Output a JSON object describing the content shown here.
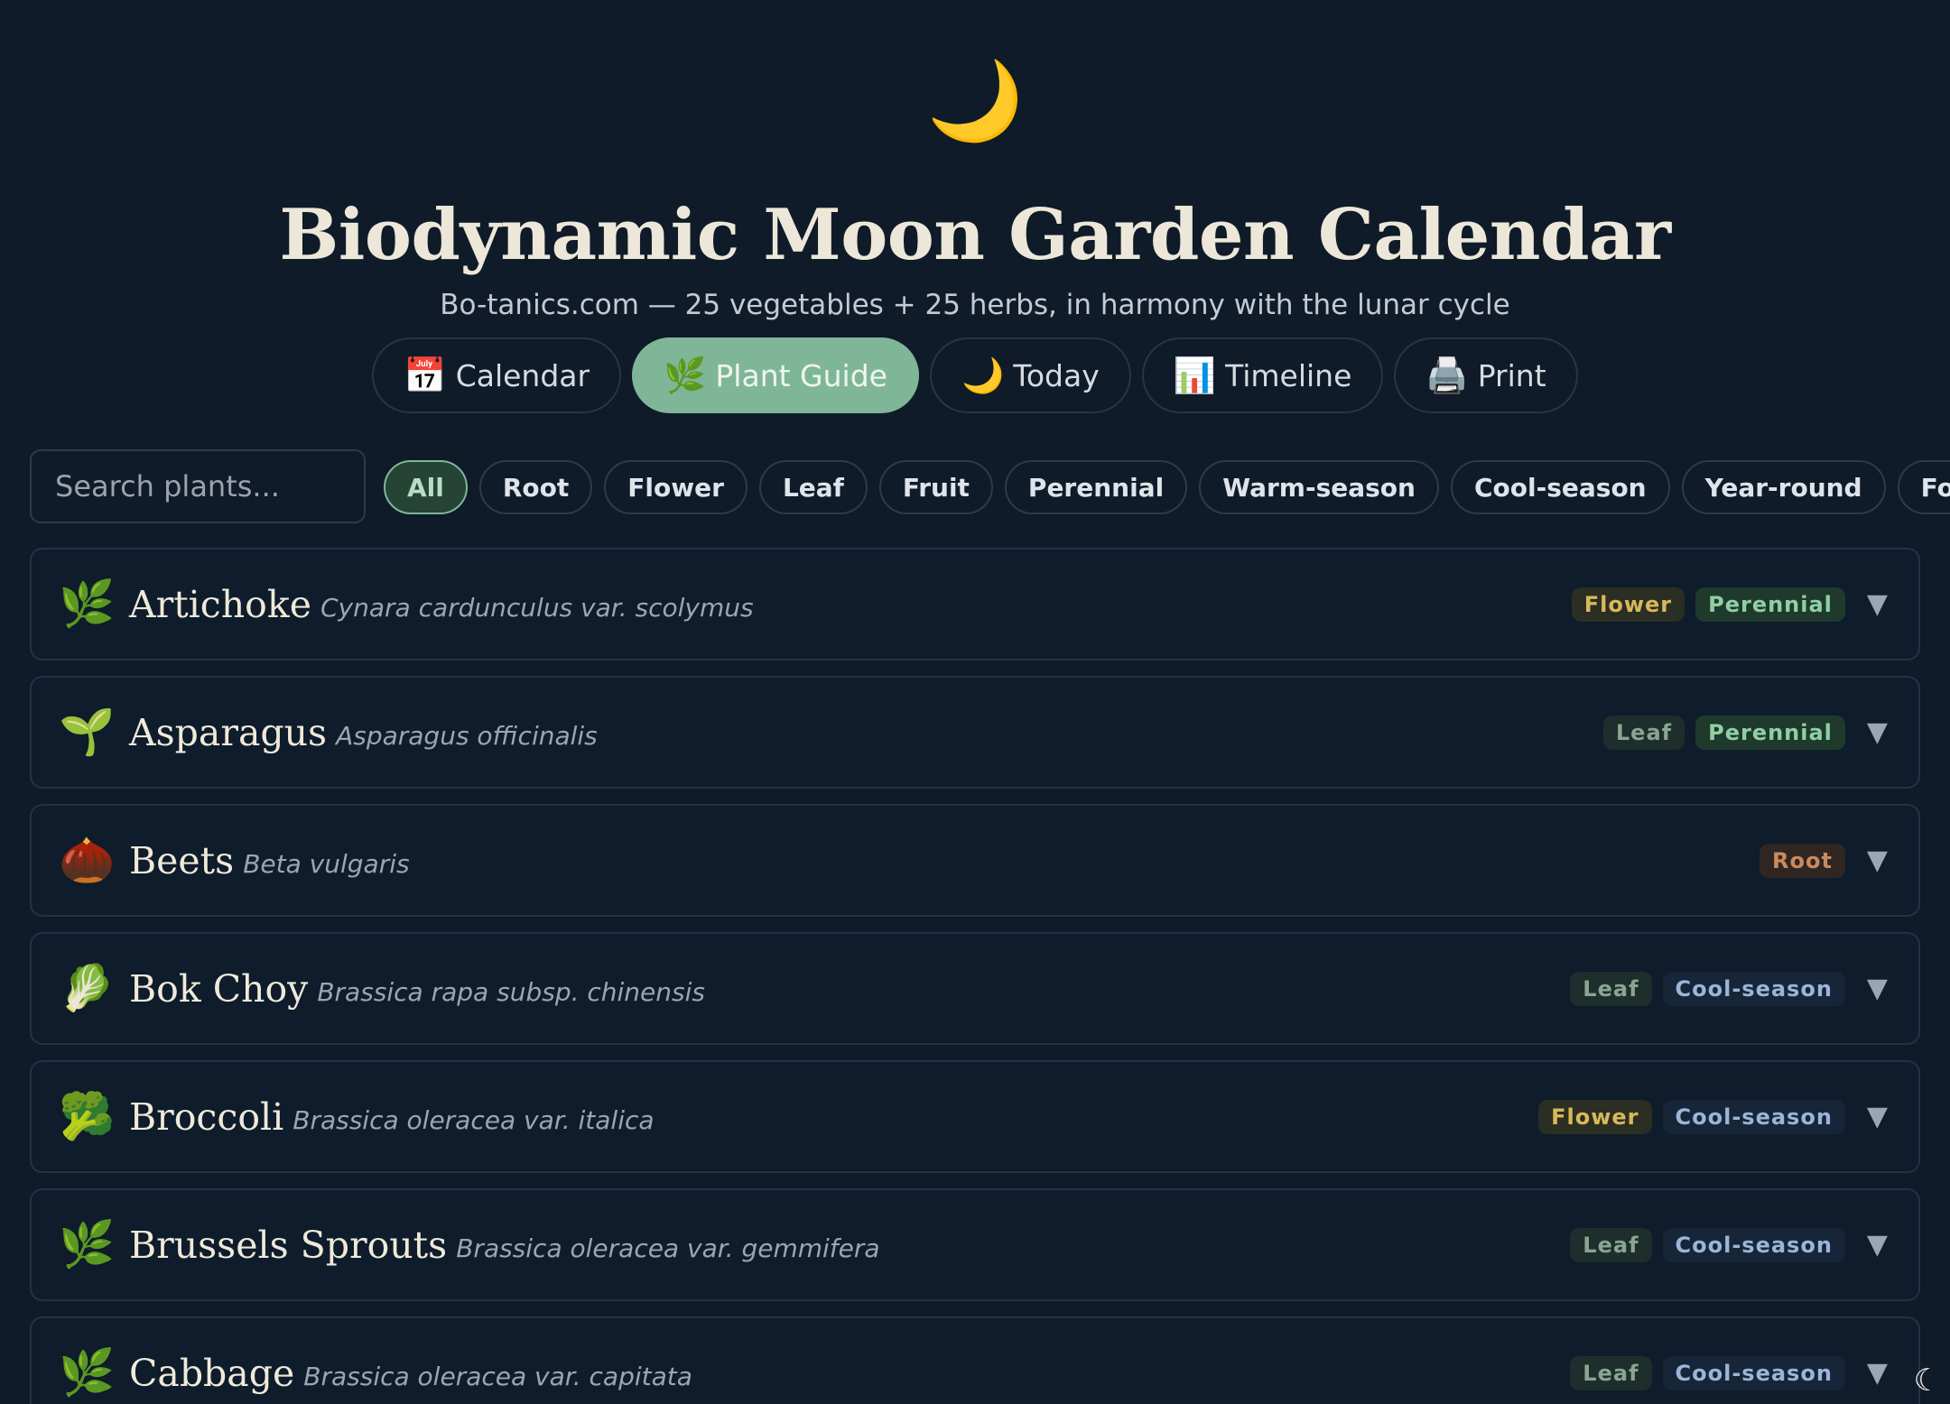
{
  "header": {
    "logo_glyph": "🌙",
    "title": "Biodynamic Moon Garden Calendar",
    "subtitle": "Bo-tanics.com — 25 vegetables + 25 herbs, in harmony with the lunar cycle"
  },
  "nav": [
    {
      "icon": "📅",
      "label": "Calendar",
      "active": false
    },
    {
      "icon": "🌿",
      "label": "Plant Guide",
      "active": true
    },
    {
      "icon": "🌙",
      "label": "Today",
      "active": false
    },
    {
      "icon": "📊",
      "label": "Timeline",
      "active": false
    },
    {
      "icon": "🖨️",
      "label": "Print",
      "active": false
    }
  ],
  "search": {
    "placeholder": "Search plants...",
    "value": ""
  },
  "filters": [
    "All",
    "Root",
    "Flower",
    "Leaf",
    "Fruit",
    "Perennial",
    "Warm-season",
    "Cool-season",
    "Year-round",
    "Forage"
  ],
  "active_filter": "All",
  "plants": [
    {
      "icon": "🌿",
      "name": "Artichoke",
      "latin": "Cynara cardunculus var. scolymus",
      "tags": [
        {
          "label": "Flower",
          "kind": "flower"
        },
        {
          "label": "Perennial",
          "kind": "perennial"
        }
      ]
    },
    {
      "icon": "🌱",
      "name": "Asparagus",
      "latin": "Asparagus officinalis",
      "tags": [
        {
          "label": "Leaf",
          "kind": "leaf"
        },
        {
          "label": "Perennial",
          "kind": "perennial"
        }
      ]
    },
    {
      "icon": "🌰",
      "name": "Beets",
      "latin": "Beta vulgaris",
      "tags": [
        {
          "label": "Root",
          "kind": "root"
        }
      ]
    },
    {
      "icon": "🥬",
      "name": "Bok Choy",
      "latin": "Brassica rapa subsp. chinensis",
      "tags": [
        {
          "label": "Leaf",
          "kind": "leaf"
        },
        {
          "label": "Cool-season",
          "kind": "cool"
        }
      ]
    },
    {
      "icon": "🥦",
      "name": "Broccoli",
      "latin": "Brassica oleracea var. italica",
      "tags": [
        {
          "label": "Flower",
          "kind": "flower"
        },
        {
          "label": "Cool-season",
          "kind": "cool"
        }
      ]
    },
    {
      "icon": "🌿",
      "name": "Brussels Sprouts",
      "latin": "Brassica oleracea var. gemmifera",
      "tags": [
        {
          "label": "Leaf",
          "kind": "leaf"
        },
        {
          "label": "Cool-season",
          "kind": "cool"
        }
      ]
    },
    {
      "icon": "🌿",
      "name": "Cabbage",
      "latin": "Brassica oleracea var. capitata",
      "tags": [
        {
          "label": "Leaf",
          "kind": "leaf"
        },
        {
          "label": "Cool-season",
          "kind": "cool"
        }
      ]
    }
  ],
  "expand_glyph": "▼",
  "corner_glyph": "☾",
  "colors": {
    "background": "#0f1b29",
    "accent": "#7fb698",
    "moon": "#f3c14b"
  }
}
